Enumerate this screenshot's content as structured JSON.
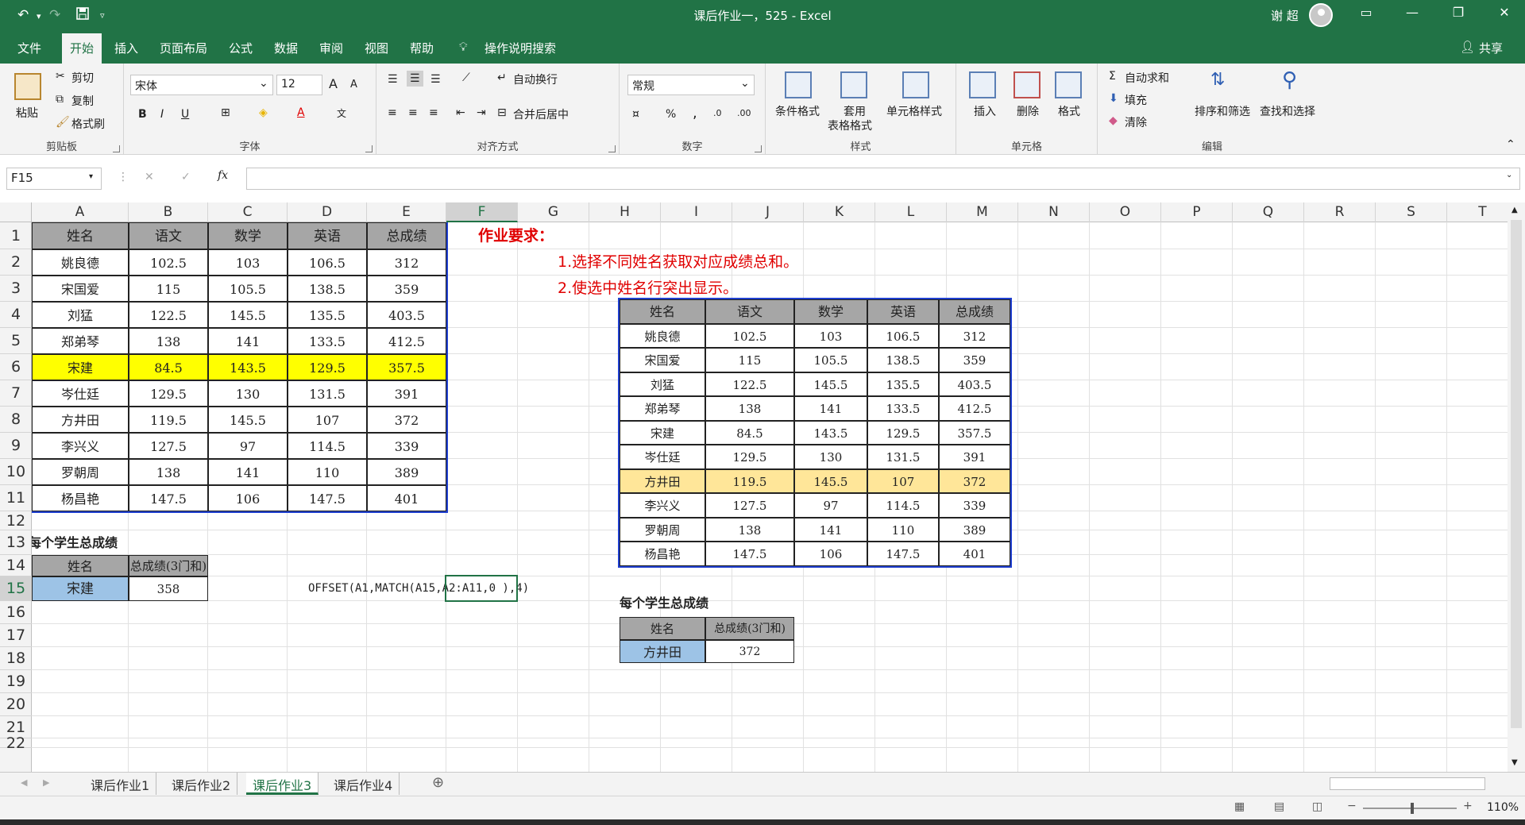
{
  "window": {
    "title": "课后作业一，525 - Excel",
    "user": "谢 超",
    "share": "共享"
  },
  "tabs": [
    "文件",
    "开始",
    "插入",
    "页面布局",
    "公式",
    "数据",
    "审阅",
    "视图",
    "帮助"
  ],
  "tell_me": "操作说明搜索",
  "ribbon": {
    "clipboard": {
      "paste": "粘贴",
      "cut": "剪切",
      "copy": "复制",
      "format_painter": "格式刷",
      "label": "剪贴板"
    },
    "font": {
      "name": "宋体",
      "size": "12",
      "label": "字体",
      "bold": "B",
      "italic": "I",
      "underline": "U",
      "grow": "A",
      "shrink": "A"
    },
    "alignment": {
      "wrap": "自动换行",
      "merge": "合并后居中",
      "label": "对齐方式"
    },
    "number": {
      "format": "常规",
      "label": "数字",
      "percent": "%",
      "comma": ","
    },
    "styles": {
      "conditional": "条件格式",
      "table1": "套用",
      "table2": "表格格式",
      "cell": "单元格样式",
      "label": "样式"
    },
    "cells": {
      "insert": "插入",
      "delete": "删除",
      "format": "格式",
      "label": "单元格"
    },
    "editing": {
      "autosum": "自动求和",
      "fill": "填充",
      "clear": "清除",
      "sort": "排序和筛选",
      "find": "查找和选择",
      "label": "编辑"
    }
  },
  "formula_bar": {
    "name_box": "F15",
    "fx": "fx",
    "formula": ""
  },
  "columns": [
    "A",
    "B",
    "C",
    "D",
    "E",
    "F",
    "G",
    "H",
    "I",
    "J",
    "K",
    "L",
    "M",
    "N",
    "O",
    "P",
    "Q",
    "R",
    "S",
    "T"
  ],
  "rows": [
    "1",
    "2",
    "3",
    "4",
    "5",
    "6",
    "7",
    "8",
    "9",
    "10",
    "11",
    "12",
    "13",
    "14",
    "15",
    "16",
    "17",
    "18",
    "19",
    "20",
    "21",
    "22"
  ],
  "left_table": {
    "headers": [
      "姓名",
      "语文",
      "数学",
      "英语",
      "总成绩"
    ],
    "rows": [
      [
        "姚良德",
        "102.5",
        "103",
        "106.5",
        "312"
      ],
      [
        "宋国爱",
        "115",
        "105.5",
        "138.5",
        "359"
      ],
      [
        "刘猛",
        "122.5",
        "145.5",
        "135.5",
        "403.5"
      ],
      [
        "郑弟琴",
        "138",
        "141",
        "133.5",
        "412.5"
      ],
      [
        "宋建",
        "84.5",
        "143.5",
        "129.5",
        "357.5"
      ],
      [
        "岑仕廷",
        "129.5",
        "130",
        "131.5",
        "391"
      ],
      [
        "方井田",
        "119.5",
        "145.5",
        "107",
        "372"
      ],
      [
        "李兴义",
        "127.5",
        "97",
        "114.5",
        "339"
      ],
      [
        "罗朝周",
        "138",
        "141",
        "110",
        "389"
      ],
      [
        "杨昌艳",
        "147.5",
        "106",
        "147.5",
        "401"
      ]
    ],
    "highlight_row": 4,
    "highlight_color": "#ffff00"
  },
  "left_summary": {
    "title": "每个学生总成绩",
    "headers": [
      "姓名",
      "总成绩(3门和)"
    ],
    "name": "宋建",
    "total": "358"
  },
  "formula_note": "OFFSET(A1,MATCH(A15,A2:A11,0  ),4)",
  "requirements": {
    "title": "作业要求：",
    "items": [
      "1.选择不同姓名获取对应成绩总和。",
      "2.使选中姓名行突出显示。"
    ],
    "color": "#e00000"
  },
  "right_table": {
    "headers": [
      "姓名",
      "语文",
      "数学",
      "英语",
      "总成绩"
    ],
    "rows": [
      [
        "姚良德",
        "102.5",
        "103",
        "106.5",
        "312"
      ],
      [
        "宋国爱",
        "115",
        "105.5",
        "138.5",
        "359"
      ],
      [
        "刘猛",
        "122.5",
        "145.5",
        "135.5",
        "403.5"
      ],
      [
        "郑弟琴",
        "138",
        "141",
        "133.5",
        "412.5"
      ],
      [
        "宋建",
        "84.5",
        "143.5",
        "129.5",
        "357.5"
      ],
      [
        "岑仕廷",
        "129.5",
        "130",
        "131.5",
        "391"
      ],
      [
        "方井田",
        "119.5",
        "145.5",
        "107",
        "372"
      ],
      [
        "李兴义",
        "127.5",
        "97",
        "114.5",
        "339"
      ],
      [
        "罗朝周",
        "138",
        "141",
        "110",
        "389"
      ],
      [
        "杨昌艳",
        "147.5",
        "106",
        "147.5",
        "401"
      ]
    ],
    "highlight_row": 6,
    "highlight_color": "#ffe699"
  },
  "right_summary": {
    "title": "每个学生总成绩",
    "headers": [
      "姓名",
      "总成绩(3门和)"
    ],
    "name": "方井田",
    "total": "372"
  },
  "sheets": [
    "课后作业1",
    "课后作业2",
    "课后作业3",
    "课后作业4"
  ],
  "active_sheet": 2,
  "status": {
    "zoom": "110%"
  },
  "colors": {
    "excel_green": "#217346",
    "header_fill": "#a6a6a6",
    "name_fill": "#9dc3e6",
    "table_border": "#1f3fd0"
  }
}
